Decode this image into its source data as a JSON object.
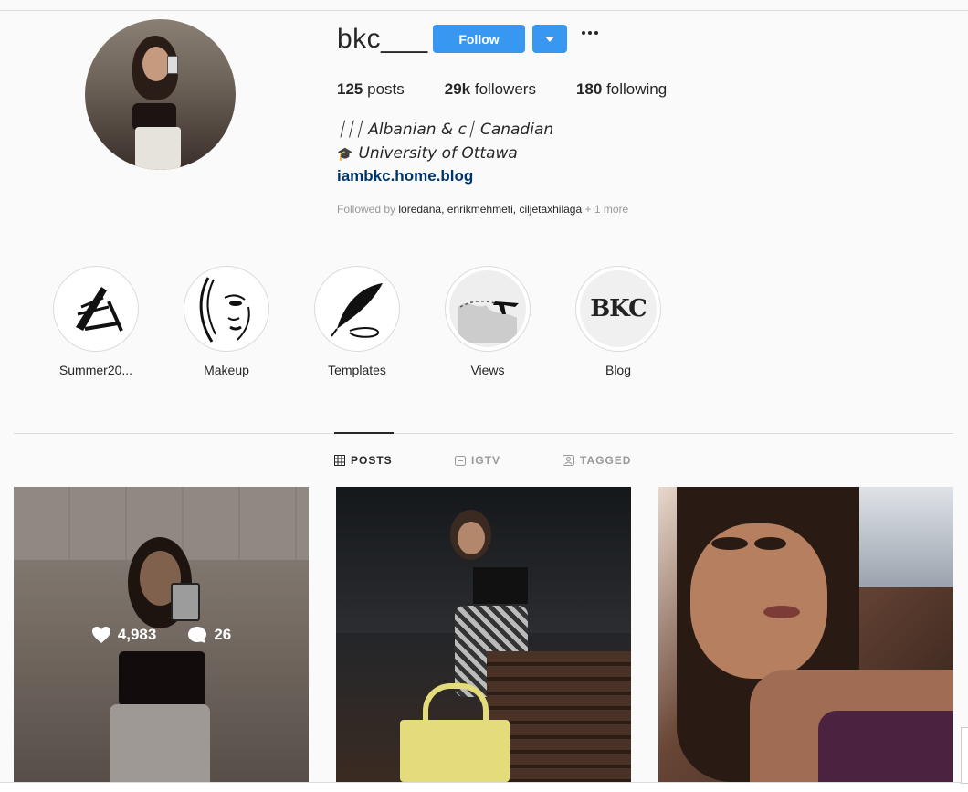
{
  "profile": {
    "username": "bkc___",
    "follow_label": "Follow",
    "stats": {
      "posts_count": "125",
      "posts_label": "posts",
      "followers_count": "29k",
      "followers_label": "followers",
      "following_count": "180",
      "following_label": "following"
    },
    "bio_line1": "⏐⏐⏐ Albanian & c⏐ Canadian",
    "bio_line2": "University of Ottawa",
    "link": "iambkc.home.blog",
    "followed_by_prefix": "Followed by",
    "followed_by_names": "loredana, enrikmehmeti, ciljetaxhilaga",
    "followed_by_more": "+ 1 more"
  },
  "highlights": [
    {
      "label": "Summer20...",
      "icon": "beach-chair-icon"
    },
    {
      "label": "Makeup",
      "icon": "face-sketch-icon"
    },
    {
      "label": "Templates",
      "icon": "feather-quill-icon"
    },
    {
      "label": "Views",
      "icon": "airplane-world-icon"
    },
    {
      "label": "Blog",
      "icon": "bkc-logo"
    }
  ],
  "highlight_logo_text": "BKC",
  "tabs": [
    {
      "label": "POSTS",
      "icon": "grid-icon",
      "active": true
    },
    {
      "label": "IGTV",
      "icon": "tv-icon",
      "active": false
    },
    {
      "label": "TAGGED",
      "icon": "tagged-icon",
      "active": false
    }
  ],
  "posts": [
    {
      "likes": "4,983",
      "comments": "26",
      "hovered": true
    },
    {
      "hovered": false
    },
    {
      "hovered": false
    }
  ],
  "colors": {
    "accent": "#3897f0",
    "link": "#003569",
    "muted": "#999999",
    "text": "#262626"
  }
}
